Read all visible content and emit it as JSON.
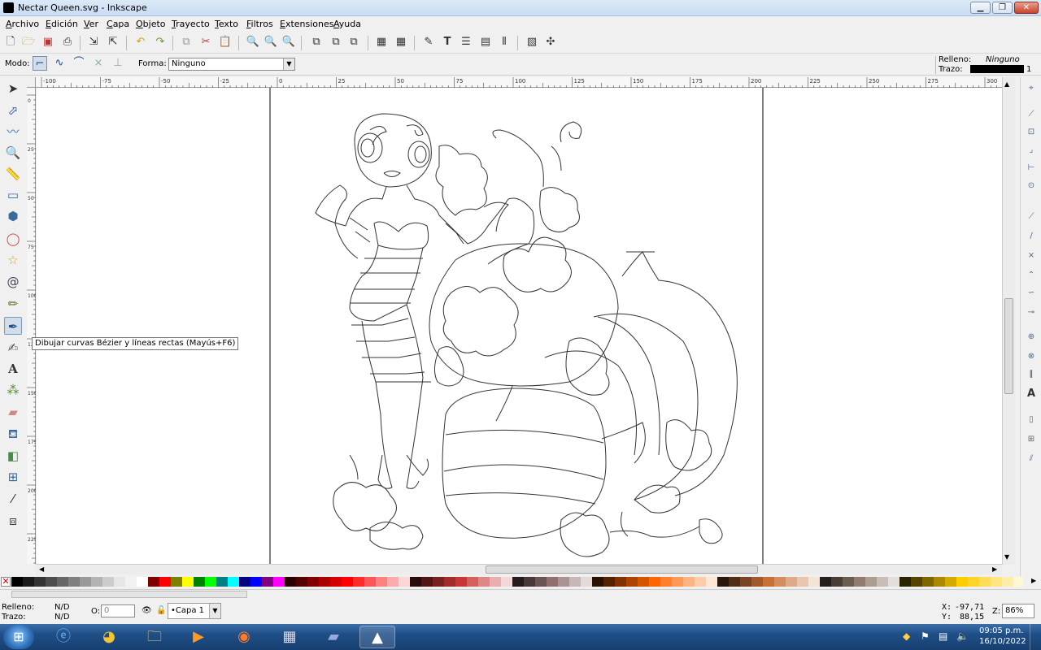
{
  "window": {
    "title": "Nectar Queen.svg - Inkscape",
    "minimize": "▁",
    "maximize": "❐",
    "close": "✕"
  },
  "menu": [
    "Archivo",
    "Edición",
    "Ver",
    "Capa",
    "Objeto",
    "Trayecto",
    "Texto",
    "Filtros",
    "Extensiones",
    "Ayuda"
  ],
  "controls": {
    "mode_label": "Modo:",
    "shape_label": "Forma:",
    "shape_value": "Ninguno",
    "fill_label": "Relleno:",
    "fill_value": "Ninguno",
    "stroke_label": "Trazo:",
    "stroke_width": "1"
  },
  "tooltip": "Dibujar curvas Bézier y líneas rectas (Mayús+F6)",
  "ruler_top_labels": [
    "-100",
    "-75",
    "-50",
    "-25",
    "0",
    "25",
    "50",
    "75",
    "100",
    "125",
    "150",
    "175",
    "200",
    "225",
    "250",
    "275",
    "300"
  ],
  "ruler_left_labels": [
    "0",
    "25",
    "50",
    "75",
    "100",
    "125",
    "150",
    "175",
    "200",
    "225"
  ],
  "status": {
    "fill_label": "Relleno:",
    "fill_value": "N/D",
    "stroke_label": "Trazo:",
    "stroke_value": "N/D",
    "opacity_label": "O:",
    "opacity_value": "0",
    "layer": "•Capa 1",
    "x_label": "X:",
    "x_value": "-97,71",
    "y_label": "Y:",
    "y_value": "88,15",
    "zoom_label": "Z:",
    "zoom_value": "86%"
  },
  "taskbar": {
    "time": "09:05 p.m.",
    "date": "16/10/2022"
  },
  "palette": [
    "#000000",
    "#1a1a1a",
    "#333333",
    "#4d4d4d",
    "#666666",
    "#808080",
    "#999999",
    "#b3b3b3",
    "#cccccc",
    "#e6e6e6",
    "#f2f2f2",
    "#ffffff",
    "#800000",
    "#ff0000",
    "#808000",
    "#ffff00",
    "#008000",
    "#00ff00",
    "#008080",
    "#00ffff",
    "#000080",
    "#0000ff",
    "#800080",
    "#ff00ff",
    "#2b0000",
    "#550000",
    "#800000",
    "#aa0000",
    "#d40000",
    "#ff0000",
    "#ff2a2a",
    "#ff5555",
    "#ff8080",
    "#ffaaaa",
    "#ffd5d5",
    "#280b0b",
    "#501616",
    "#782121",
    "#a02c2c",
    "#c83737",
    "#d35f5f",
    "#de8787",
    "#e9afaf",
    "#f4d7d7",
    "#241c1c",
    "#483737",
    "#6c5353",
    "#916f6f",
    "#ac9393",
    "#c8b7b7",
    "#e3dbdb",
    "#2b1100",
    "#552200",
    "#803300",
    "#aa4400",
    "#d45500",
    "#ff6600",
    "#ff7f2a",
    "#ff9955",
    "#ffb380",
    "#ffccaa",
    "#ffe6d5",
    "#28170b",
    "#502d16",
    "#784421",
    "#a05a2c",
    "#c87137",
    "#d38d5f",
    "#deaa87",
    "#e9c6af",
    "#f4e3d7",
    "#241f1c",
    "#483e37",
    "#6c5d53",
    "#917c6f",
    "#ac9d93",
    "#c8beb7",
    "#e3dedb",
    "#2b2200",
    "#554400",
    "#806600",
    "#aa8800",
    "#d4aa00",
    "#ffcc00",
    "#ffd42a",
    "#ffdd55",
    "#ffe680",
    "#ffeeaa",
    "#fff6d5",
    "#28220b",
    "#504416",
    "#786721",
    "#a0892c",
    "#c8ab37",
    "#d3bc5f",
    "#decd87",
    "#e9ddaf",
    "#f4eed7"
  ]
}
